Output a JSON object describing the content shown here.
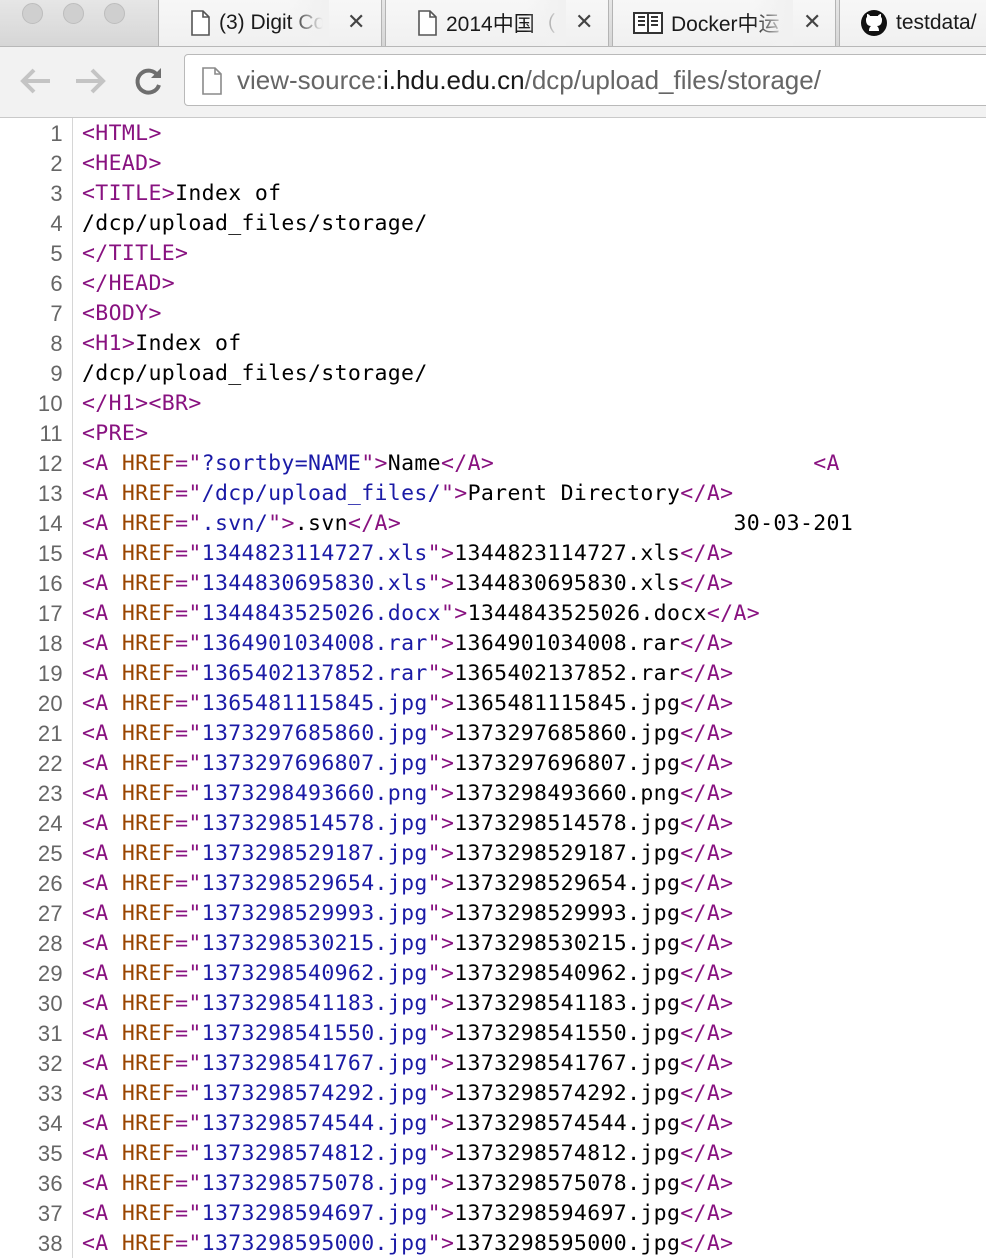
{
  "browser": {
    "tabs": [
      {
        "title": "(3) Digit Co",
        "icon": "page-icon"
      },
      {
        "title": "2014中国（",
        "icon": "page-icon"
      },
      {
        "title": "Docker中运",
        "icon": "book-icon"
      },
      {
        "title": "testdata/",
        "icon": "github-icon"
      }
    ],
    "address": {
      "scheme": "view-source:",
      "host": "i.hdu.edu.cn",
      "path": "/dcp/upload_files/storage/"
    }
  },
  "source": {
    "line_numbers": [
      "1",
      "2",
      "3",
      "4",
      "5",
      "6",
      "7",
      "8",
      "9",
      "10",
      "11",
      "12",
      "13",
      "14",
      "15",
      "16",
      "17",
      "18",
      "19",
      "20",
      "21",
      "22",
      "23",
      "24",
      "25",
      "26",
      "27",
      "28",
      "29",
      "30",
      "31",
      "32",
      "33",
      "34",
      "35",
      "36",
      "37",
      "38"
    ],
    "head_lines": [
      [
        {
          "k": "tag",
          "t": "<HTML>"
        }
      ],
      [
        {
          "k": "tag",
          "t": "<HEAD>"
        }
      ],
      [
        {
          "k": "tag",
          "t": "<TITLE>"
        },
        {
          "k": "txt",
          "t": "Index of"
        }
      ],
      [
        {
          "k": "txt",
          "t": "/dcp/upload_files/storage/"
        }
      ],
      [
        {
          "k": "tag",
          "t": "</TITLE>"
        }
      ],
      [
        {
          "k": "tag",
          "t": "</HEAD>"
        }
      ],
      [
        {
          "k": "tag",
          "t": "<BODY>"
        }
      ],
      [
        {
          "k": "tag",
          "t": "<H1>"
        },
        {
          "k": "txt",
          "t": "Index of"
        }
      ],
      [
        {
          "k": "txt",
          "t": "/dcp/upload_files/storage/"
        }
      ],
      [
        {
          "k": "tag",
          "t": "</H1><BR>"
        }
      ],
      [
        {
          "k": "tag",
          "t": "<PRE>"
        }
      ],
      [
        {
          "k": "tag",
          "t": "<A "
        },
        {
          "k": "attr",
          "t": "HREF"
        },
        {
          "k": "tag",
          "t": "=\""
        },
        {
          "k": "val",
          "t": "?sortby=NAME"
        },
        {
          "k": "tag",
          "t": "\">"
        },
        {
          "k": "txt",
          "t": "Name"
        },
        {
          "k": "tag",
          "t": "</A>"
        },
        {
          "k": "txt",
          "t": "                        "
        },
        {
          "k": "tag",
          "t": "<A"
        }
      ],
      [
        {
          "k": "tag",
          "t": "<A "
        },
        {
          "k": "attr",
          "t": "HREF"
        },
        {
          "k": "tag",
          "t": "=\""
        },
        {
          "k": "val",
          "t": "/dcp/upload_files/"
        },
        {
          "k": "tag",
          "t": "\">"
        },
        {
          "k": "txt",
          "t": "Parent Directory"
        },
        {
          "k": "tag",
          "t": "</A>"
        }
      ],
      [
        {
          "k": "tag",
          "t": "<A "
        },
        {
          "k": "attr",
          "t": "HREF"
        },
        {
          "k": "tag",
          "t": "=\""
        },
        {
          "k": "val",
          "t": ".svn/"
        },
        {
          "k": "tag",
          "t": "\">"
        },
        {
          "k": "txt",
          "t": ".svn"
        },
        {
          "k": "tag",
          "t": "</A>"
        },
        {
          "k": "txt",
          "t": "                         30-03-201"
        }
      ]
    ],
    "files": [
      "1344823114727.xls",
      "1344830695830.xls",
      "1344843525026.docx",
      "1364901034008.rar",
      "1365402137852.rar",
      "1365481115845.jpg",
      "1373297685860.jpg",
      "1373297696807.jpg",
      "1373298493660.png",
      "1373298514578.jpg",
      "1373298529187.jpg",
      "1373298529654.jpg",
      "1373298529993.jpg",
      "1373298530215.jpg",
      "1373298540962.jpg",
      "1373298541183.jpg",
      "1373298541550.jpg",
      "1373298541767.jpg",
      "1373298574292.jpg",
      "1373298574544.jpg",
      "1373298574812.jpg",
      "1373298575078.jpg",
      "1373298594697.jpg",
      "1373298595000.jpg"
    ],
    "markup": {
      "open": "<A ",
      "attr": "HREF",
      "eq": "=\"",
      "close_attr": "\">",
      "close": "</A>"
    }
  }
}
